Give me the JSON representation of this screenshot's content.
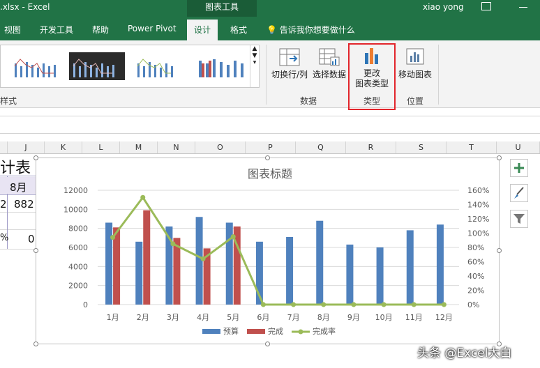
{
  "titlebar": {
    "filename": ".xlsx",
    "separator": "-",
    "app": "Excel",
    "contextual_tab": "图表工具",
    "user": "xiao yong"
  },
  "tabs": [
    "视图",
    "开发工具",
    "帮助",
    "Power Pivot",
    "设计",
    "格式"
  ],
  "active_tab": "设计",
  "tell_me": "告诉我你想要做什么",
  "ribbon": {
    "styles_group": "样式",
    "data_group": {
      "label": "数据",
      "switch_row_col": "切换行/列",
      "select_data": "选择数据"
    },
    "type_group": {
      "label": "类型",
      "change_type_line1": "更改",
      "change_type_line2": "图表类型"
    },
    "location_group": {
      "label": "位置",
      "move_chart": "移动图表"
    }
  },
  "columns": [
    "J",
    "K",
    "L",
    "M",
    "N",
    "O",
    "P",
    "Q",
    "R",
    "S",
    "T",
    "U"
  ],
  "cells": {
    "title_fragment": "计表",
    "header_month": "8月",
    "value_left": "2",
    "value_right": "882",
    "pct_left": "%",
    "pct_right": "0"
  },
  "side_buttons": [
    "chart-elements-icon",
    "chart-styles-icon",
    "chart-filters-icon"
  ],
  "watermark": "头条 @Excel大白",
  "colors": {
    "accent": "#217346",
    "budget": "#4f81bd",
    "done": "#c0504d",
    "rate": "#9bbb59",
    "highlight": "#e2252b"
  },
  "chart_data": {
    "type": "bar",
    "title": "图表标题",
    "categories": [
      "1月",
      "2月",
      "3月",
      "4月",
      "5月",
      "6月",
      "7月",
      "8月",
      "9月",
      "10月",
      "11月",
      "12月"
    ],
    "series": [
      {
        "name": "预算",
        "type": "bar",
        "axis": "left",
        "values": [
          8600,
          6600,
          8200,
          9200,
          8600,
          6600,
          7100,
          8800,
          6300,
          6000,
          7800,
          8400
        ]
      },
      {
        "name": "完成",
        "type": "bar",
        "axis": "left",
        "values": [
          8100,
          9900,
          7000,
          5900,
          8200,
          null,
          null,
          null,
          null,
          null,
          null,
          null
        ]
      },
      {
        "name": "完成率",
        "type": "line",
        "axis": "right",
        "values": [
          0.94,
          1.5,
          0.85,
          0.64,
          0.95,
          0,
          0,
          0,
          0,
          0,
          0,
          0
        ]
      }
    ],
    "y_left": {
      "min": 0,
      "max": 12000,
      "ticks": [
        0,
        2000,
        4000,
        6000,
        8000,
        10000,
        12000
      ],
      "labels": [
        "0",
        "2000",
        "4000",
        "6000",
        "8000",
        "10000",
        "12000"
      ]
    },
    "y_right": {
      "min": 0,
      "max": 1.6,
      "ticks": [
        0,
        0.2,
        0.4,
        0.6,
        0.8,
        1.0,
        1.2,
        1.4,
        1.6
      ],
      "labels": [
        "0%",
        "20%",
        "40%",
        "60%",
        "80%",
        "100%",
        "120%",
        "140%",
        "160%"
      ]
    },
    "grid": true,
    "legend_position": "bottom"
  }
}
